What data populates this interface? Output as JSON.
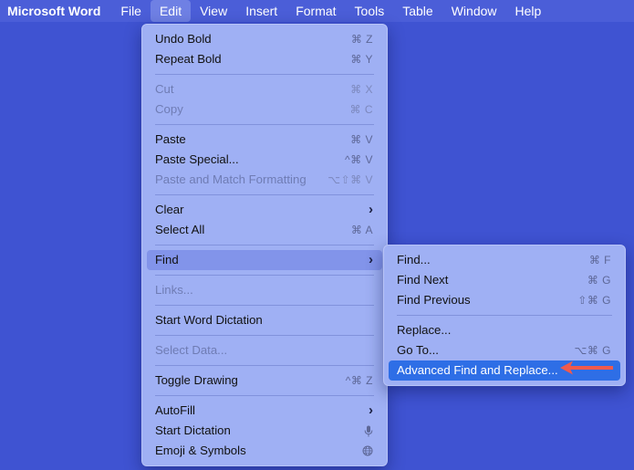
{
  "menubar": {
    "app": "Microsoft Word",
    "items": [
      "File",
      "Edit",
      "View",
      "Insert",
      "Format",
      "Tools",
      "Table",
      "Window",
      "Help"
    ]
  },
  "edit_menu": {
    "undo": {
      "label": "Undo Bold",
      "shortcut": "⌘ Z"
    },
    "repeat": {
      "label": "Repeat Bold",
      "shortcut": "⌘ Y"
    },
    "cut": {
      "label": "Cut",
      "shortcut": "⌘ X"
    },
    "copy": {
      "label": "Copy",
      "shortcut": "⌘ C"
    },
    "paste": {
      "label": "Paste",
      "shortcut": "⌘ V"
    },
    "paste_special": {
      "label": "Paste Special...",
      "shortcut": "^⌘ V"
    },
    "paste_match": {
      "label": "Paste and Match Formatting",
      "shortcut": "⌥⇧⌘ V"
    },
    "clear": {
      "label": "Clear"
    },
    "select_all": {
      "label": "Select All",
      "shortcut": "⌘ A"
    },
    "find": {
      "label": "Find"
    },
    "links": {
      "label": "Links..."
    },
    "start_word_dictation": {
      "label": "Start Word Dictation"
    },
    "select_data": {
      "label": "Select Data..."
    },
    "toggle_drawing": {
      "label": "Toggle Drawing",
      "shortcut": "^⌘ Z"
    },
    "autofill": {
      "label": "AutoFill"
    },
    "start_dictation": {
      "label": "Start Dictation"
    },
    "emoji": {
      "label": "Emoji & Symbols"
    }
  },
  "find_menu": {
    "find": {
      "label": "Find...",
      "shortcut": "⌘ F"
    },
    "find_next": {
      "label": "Find Next",
      "shortcut": "⌘ G"
    },
    "find_previous": {
      "label": "Find Previous",
      "shortcut": "⇧⌘ G"
    },
    "replace": {
      "label": "Replace..."
    },
    "go_to": {
      "label": "Go To...",
      "shortcut": "⌥⌘ G"
    },
    "advanced": {
      "label": "Advanced Find and Replace..."
    }
  },
  "icons": {
    "submenu": "chevron-right-icon",
    "dictation": "microphone-icon",
    "emoji": "globe-icon",
    "annotation": "red-arrow-icon"
  },
  "colors": {
    "desktop": "#3f53d2",
    "menu_bg": "#9fb0f4",
    "highlight": "#8294ea",
    "selected": "#2e6ee6",
    "annotation_arrow": "#ef5a4c"
  }
}
